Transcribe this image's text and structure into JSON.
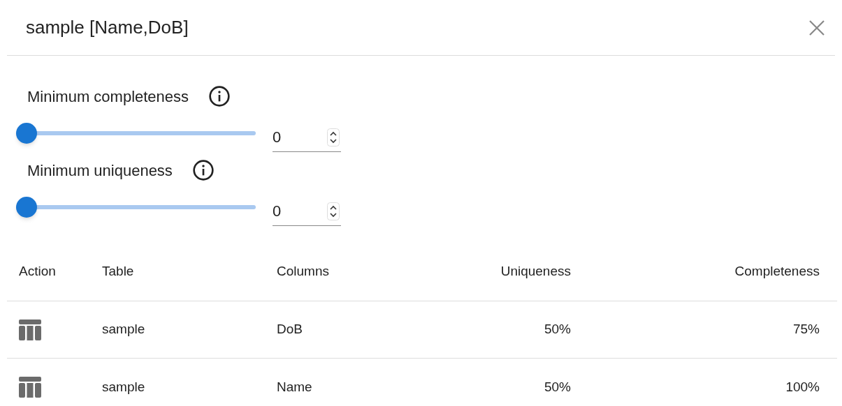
{
  "dialog": {
    "title": "sample [Name,DoB]"
  },
  "filters": [
    {
      "label": "Minimum completeness",
      "level": 0,
      "value": "0"
    },
    {
      "label": "Minimum uniqueness",
      "level": 0,
      "value": "0"
    }
  ],
  "table": {
    "columns": [
      "Action",
      "Table",
      "Columns",
      "Uniqueness",
      "Completeness"
    ],
    "rows": [
      {
        "table": "sample",
        "columns": "DoB",
        "uniqueness": "50%",
        "completeness": "75%"
      },
      {
        "table": "sample",
        "columns": "Name",
        "uniqueness": "50%",
        "completeness": "100%"
      }
    ]
  }
}
